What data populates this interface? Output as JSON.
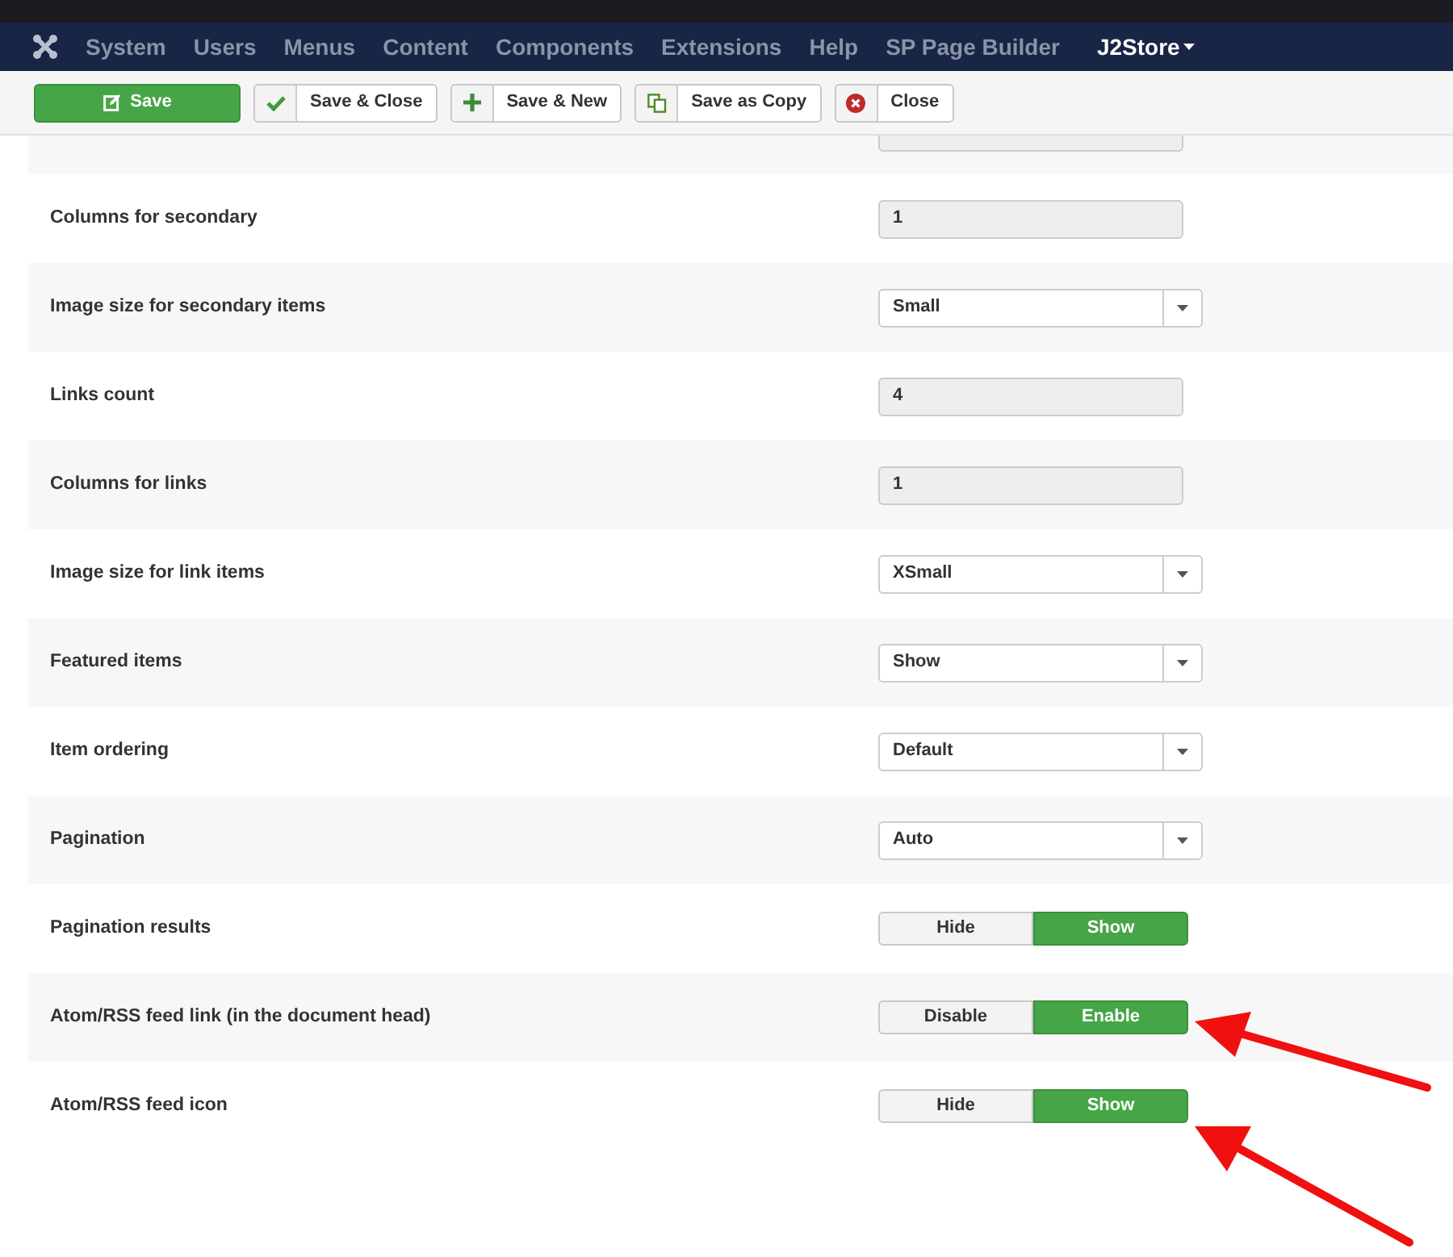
{
  "nav": {
    "items": [
      "System",
      "Users",
      "Menus",
      "Content",
      "Components",
      "Extensions",
      "Help",
      "SP Page Builder"
    ],
    "dropdown": "J2Store"
  },
  "toolbar": [
    {
      "kind": "save",
      "label": "Save"
    },
    {
      "kind": "check",
      "label": "Save & Close"
    },
    {
      "kind": "plus",
      "label": "Save & New"
    },
    {
      "kind": "copy",
      "label": "Save as Copy"
    },
    {
      "kind": "close",
      "label": "Close"
    }
  ],
  "rows": [
    {
      "kind": "input",
      "label": "Columns for secondary",
      "value": "1"
    },
    {
      "kind": "select",
      "label": "Image size for secondary items",
      "value": "Small"
    },
    {
      "kind": "input",
      "label": "Links count",
      "value": "4"
    },
    {
      "kind": "input",
      "label": "Columns for links",
      "value": "1"
    },
    {
      "kind": "select",
      "label": "Image size for link items",
      "value": "XSmall"
    },
    {
      "kind": "select",
      "label": "Featured items",
      "value": "Show"
    },
    {
      "kind": "select",
      "label": "Item ordering",
      "value": "Default"
    },
    {
      "kind": "select",
      "label": "Pagination",
      "value": "Auto"
    },
    {
      "kind": "toggle",
      "label": "Pagination results",
      "options": [
        {
          "label": "Hide",
          "selected": false
        },
        {
          "label": "Show",
          "selected": true
        }
      ]
    },
    {
      "kind": "toggle",
      "label": "Atom/RSS feed link (in the document head)",
      "options": [
        {
          "label": "Disable",
          "selected": false
        },
        {
          "label": "Enable",
          "selected": true
        }
      ]
    },
    {
      "kind": "toggle",
      "label": "Atom/RSS feed icon",
      "options": [
        {
          "label": "Hide",
          "selected": false
        },
        {
          "label": "Show",
          "selected": true
        }
      ]
    }
  ]
}
